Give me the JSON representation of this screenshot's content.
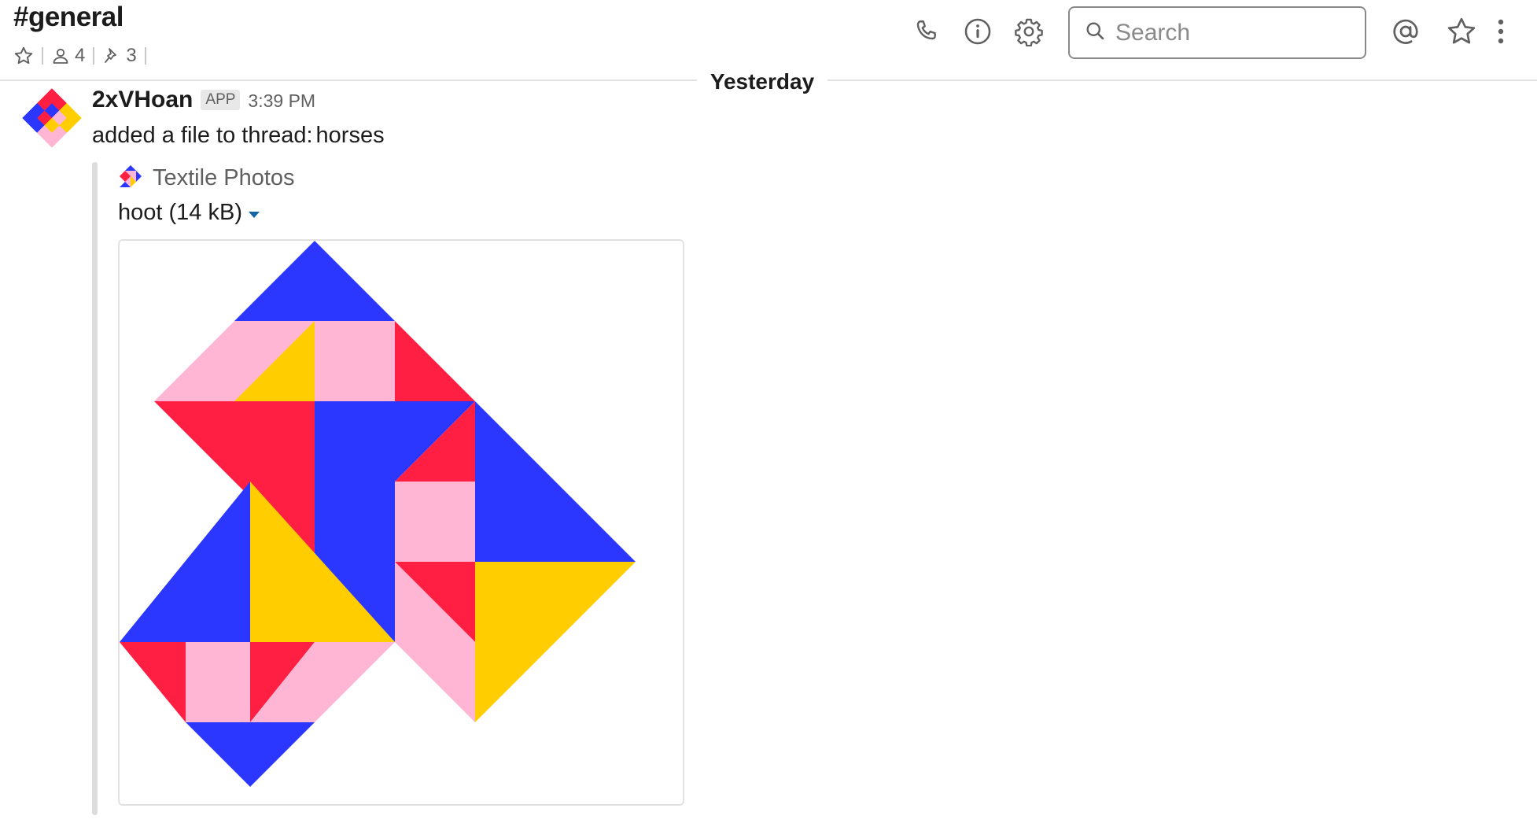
{
  "header": {
    "channel_name": "#general",
    "member_count": "4",
    "pinned_count": "3",
    "search_placeholder": "Search"
  },
  "divider": {
    "label": "Yesterday"
  },
  "message": {
    "sender": "2xVHoan",
    "badge": "APP",
    "time": "3:39 PM",
    "text": "added a file to thread:",
    "thread_name": "horses",
    "attachment": {
      "service_name": "Textile Photos",
      "file_title": "hoot (14 kB)"
    }
  },
  "icons": {
    "header": [
      "star-outline-icon",
      "person-icon",
      "pin-icon",
      "phone-icon",
      "info-icon",
      "gear-icon",
      "search-icon",
      "at-mention-icon",
      "star-icon",
      "more-vertical-icon"
    ],
    "attachment": [
      "textile-logo-icon",
      "chevron-down-icon"
    ]
  },
  "colors": {
    "blue": "#2b37ff",
    "pink": "#ffb6d5",
    "red": "#ff1f43",
    "yellow": "#ffcd00",
    "link_accent": "#1264a3"
  }
}
